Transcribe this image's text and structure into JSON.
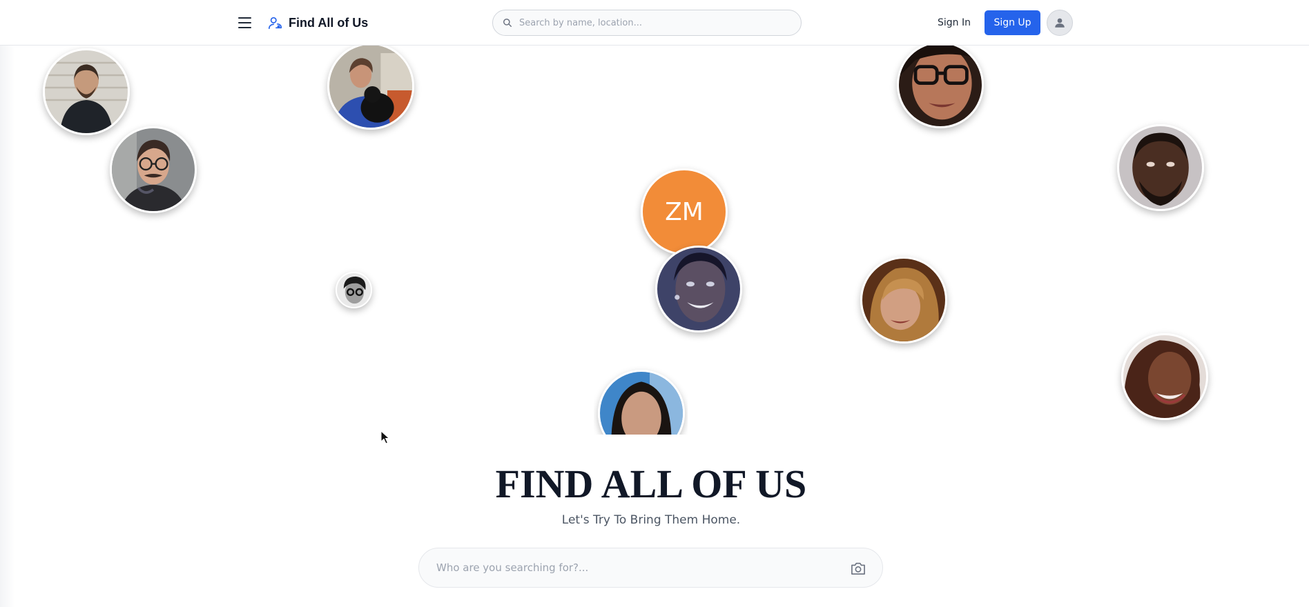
{
  "header": {
    "menu_icon": "hamburger-icon",
    "brand": {
      "icon": "people-outline-icon",
      "name": "Find All of Us",
      "icon_color": "#2563eb"
    },
    "search": {
      "icon": "search-icon",
      "placeholder": "Search by name, location..."
    },
    "sign_in_label": "Sign In",
    "sign_up_label": "Sign Up",
    "profile_icon": "user-avatar-icon",
    "accent_color": "#2563eb"
  },
  "profiles": [
    {
      "kind": "photo",
      "description_icon": "person-photo-icon"
    },
    {
      "kind": "photo",
      "description_icon": "person-photo-icon"
    },
    {
      "kind": "photo",
      "description_icon": "person-photo-icon"
    },
    {
      "kind": "photo",
      "description_icon": "person-photo-icon"
    },
    {
      "kind": "photo",
      "description_icon": "person-photo-icon"
    },
    {
      "kind": "initials",
      "initials": "ZM",
      "color": "#f28c38"
    },
    {
      "kind": "photo",
      "description_icon": "person-photo-icon"
    },
    {
      "kind": "photo",
      "description_icon": "person-photo-icon"
    },
    {
      "kind": "photo",
      "description_icon": "person-photo-icon"
    },
    {
      "kind": "photo",
      "description_icon": "person-photo-icon"
    },
    {
      "kind": "photo",
      "description_icon": "person-photo-icon"
    }
  ],
  "hero": {
    "title": "FIND ALL OF US",
    "subtitle": "Let's Try To Bring Them Home.",
    "search": {
      "placeholder": "Who are you searching for?...",
      "icon": "camera-icon"
    }
  }
}
